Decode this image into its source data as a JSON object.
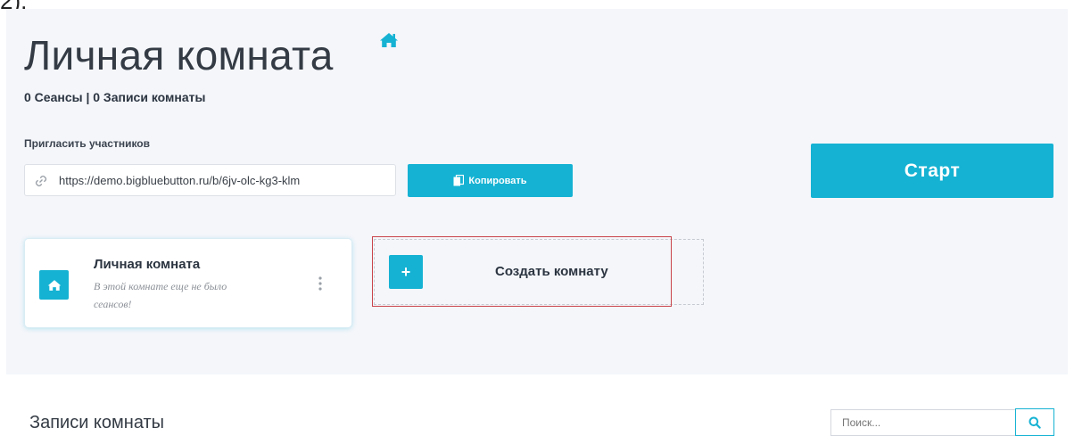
{
  "room": {
    "title": "Личная комната",
    "stats": "0 Сеансы | 0 Записи комнаты",
    "invite_label": "Пригласить участников",
    "invite_url": "https://demo.bigbluebutton.ru/b/6jv-olc-kg3-klm",
    "copy_label": "Копировать",
    "start_label": "Старт"
  },
  "rooms": {
    "card": {
      "title": "Личная комната",
      "subtitle": "В этой комнате еще не было сеансов!"
    },
    "create_label": "Создать комнату",
    "create_symbol": "+"
  },
  "recordings": {
    "title": "Записи комнаты",
    "search_placeholder": "Поиск..."
  },
  "top_fragment": "2).",
  "colors": {
    "accent": "#15b2d3",
    "panel_bg": "#f4f6fa",
    "highlight_border": "#c9444a"
  },
  "icons": [
    "home-icon",
    "link-icon",
    "copy-icon",
    "kebab-menu-icon",
    "plus-icon",
    "search-icon"
  ]
}
